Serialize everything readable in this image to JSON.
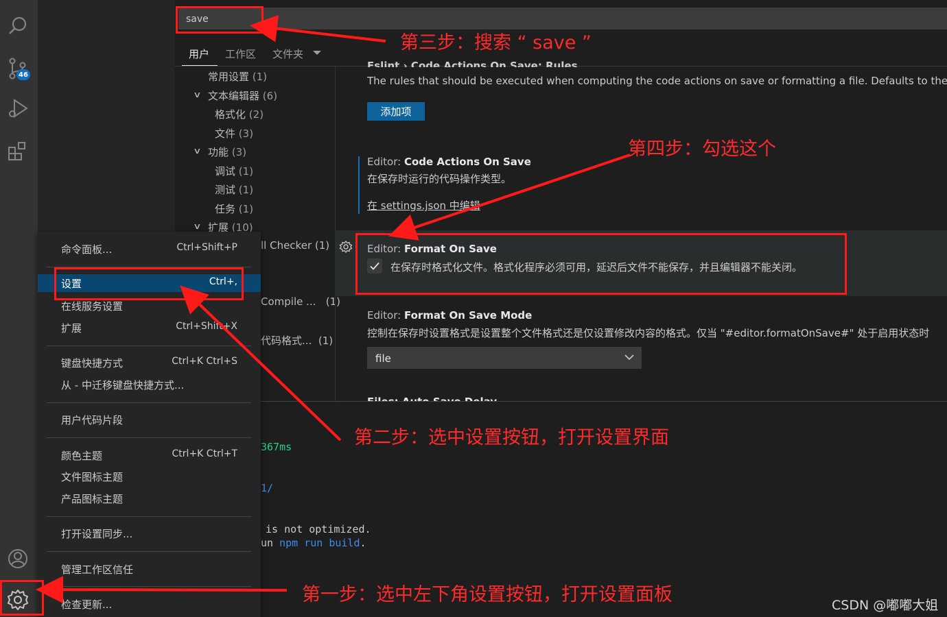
{
  "activity_bar": {
    "scm_badge": "46",
    "icons": [
      "search-icon",
      "source-control-icon",
      "run-debug-icon",
      "extensions-icon",
      "account-icon",
      "manage-gear-icon"
    ]
  },
  "search": {
    "value": "save"
  },
  "tabs": {
    "user": "用户",
    "workspace": "工作区",
    "folder": "文件夹"
  },
  "toc": [
    {
      "label": "常用设置",
      "count": "(1)"
    },
    {
      "label": "文本编辑器",
      "count": "(6)"
    },
    {
      "label": "格式化",
      "count": "(2)"
    },
    {
      "label": "文件",
      "count": "(3)"
    },
    {
      "label": "功能",
      "count": "(3)"
    },
    {
      "label": "调试",
      "count": "(1)"
    },
    {
      "label": "测试",
      "count": "(1)"
    },
    {
      "label": "任务",
      "count": "(1)"
    },
    {
      "label": "扩展",
      "count": "(10)"
    }
  ],
  "toc_partial": [
    {
      "label": "ll Checker",
      "count": "(1)"
    },
    {
      "label": "Compile ...",
      "count": "(1)"
    },
    {
      "label": "代码格式...",
      "count": "(1)"
    }
  ],
  "settings": {
    "eslint_cut_title": "Eslint › Code Actions On Save: Rules",
    "eslint_desc": "The rules that should be executed when computing the code actions on save or formatting a file. Defaults to the rules",
    "add_item": "添加项",
    "code_actions": {
      "category": "Editor: ",
      "name": "Code Actions On Save",
      "desc": "在保存时运行的代码操作类型。",
      "link": "在 settings.json 中编辑"
    },
    "format_on_save": {
      "category": "Editor: ",
      "name": "Format On Save",
      "desc": "在保存时格式化文件。格式化程序必须可用，延迟后文件不能保存，并且编辑器不能关闭。",
      "checked": true
    },
    "format_on_save_mode": {
      "category": "Editor: ",
      "name": "Format On Save Mode",
      "desc": "控制在保存时设置格式是设置整个文件格式还是仅设置修改内容的格式。仅当 \"#editor.formatOnSave#\" 处于启用状态时",
      "value": "file"
    },
    "cut_bottom": "Files: Auto Save Delay"
  },
  "terminal": {
    "line1": "367ms",
    "line2": "1/",
    "line3_a": " is not optimized.",
    "line4_a": "un ",
    "line4_b": "npm run build",
    "line4_c": "."
  },
  "menu": {
    "items": [
      {
        "label": "命令面板...",
        "key": "Ctrl+Shift+P"
      },
      {
        "label": "设置",
        "key": "Ctrl+,"
      },
      {
        "label": "在线服务设置",
        "key": ""
      },
      {
        "label": "扩展",
        "key": "Ctrl+Shift+X"
      },
      {
        "label": "键盘快捷方式",
        "key": "Ctrl+K Ctrl+S"
      },
      {
        "label": "从 - 中迁移键盘快捷方式...",
        "key": ""
      },
      {
        "label": "用户代码片段",
        "key": ""
      },
      {
        "label": "颜色主题",
        "key": "Ctrl+K Ctrl+T"
      },
      {
        "label": "文件图标主题",
        "key": ""
      },
      {
        "label": "产品图标主题",
        "key": ""
      },
      {
        "label": "打开设置同步...",
        "key": ""
      },
      {
        "label": "管理工作区信任",
        "key": ""
      },
      {
        "label": "检查更新...",
        "key": ""
      }
    ]
  },
  "annotations": {
    "step1": "第一步：选中左下角设置按钮，打开设置面板",
    "step2": "第二步：选中设置按钮，打开设置界面",
    "step3": "第三步：搜索 “ save ”",
    "step4": "第四步：勾选这个"
  },
  "watermark": "CSDN @嘟嘟大姐",
  "colors": {
    "accent": "#0e639c",
    "selection": "#094771",
    "annotation_red": "#ff1a1a"
  }
}
